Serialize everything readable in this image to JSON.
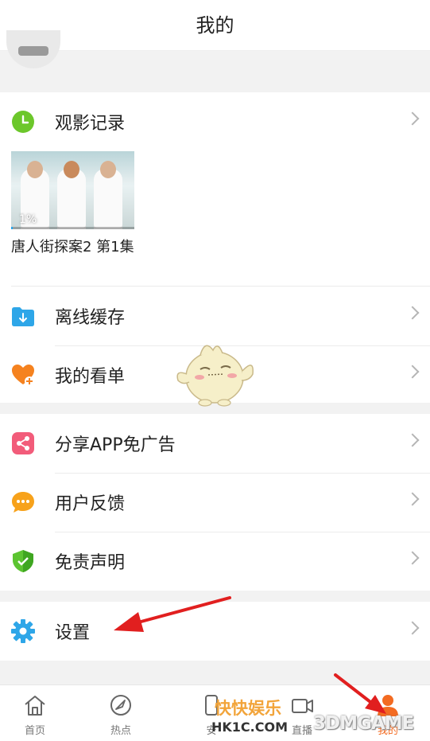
{
  "header": {
    "title": "我的"
  },
  "history": {
    "label": "观影记录",
    "icon": "clock-icon",
    "video": {
      "title": "唐人街探案2 第1集",
      "progress_label": "1%",
      "progress": 0.01
    }
  },
  "menu_group_1": [
    {
      "label": "离线缓存",
      "icon": "download-folder-icon"
    },
    {
      "label": "我的看单",
      "icon": "heart-plus-icon"
    }
  ],
  "menu_group_2": [
    {
      "label": "分享APP免广告",
      "icon": "share-icon"
    },
    {
      "label": "用户反馈",
      "icon": "chat-bubble-icon"
    },
    {
      "label": "免责声明",
      "icon": "shield-icon"
    }
  ],
  "settings": {
    "label": "设置",
    "icon": "gear-icon"
  },
  "tabbar": {
    "items": [
      {
        "label": "首页",
        "icon": "home-icon"
      },
      {
        "label": "热点",
        "icon": "compass-icon"
      },
      {
        "label": "安",
        "icon": "phone-icon"
      },
      {
        "label": "直播",
        "icon": "camera-icon"
      },
      {
        "label": "我的",
        "icon": "person-icon"
      }
    ]
  },
  "watermark": {
    "text1": "快快娱乐",
    "text2": "HK1C.COM",
    "text3": "3DMGAME"
  },
  "colors": {
    "accent": "#f36b22",
    "blue": "#23a6f0",
    "arrow": "#e11f1f"
  }
}
